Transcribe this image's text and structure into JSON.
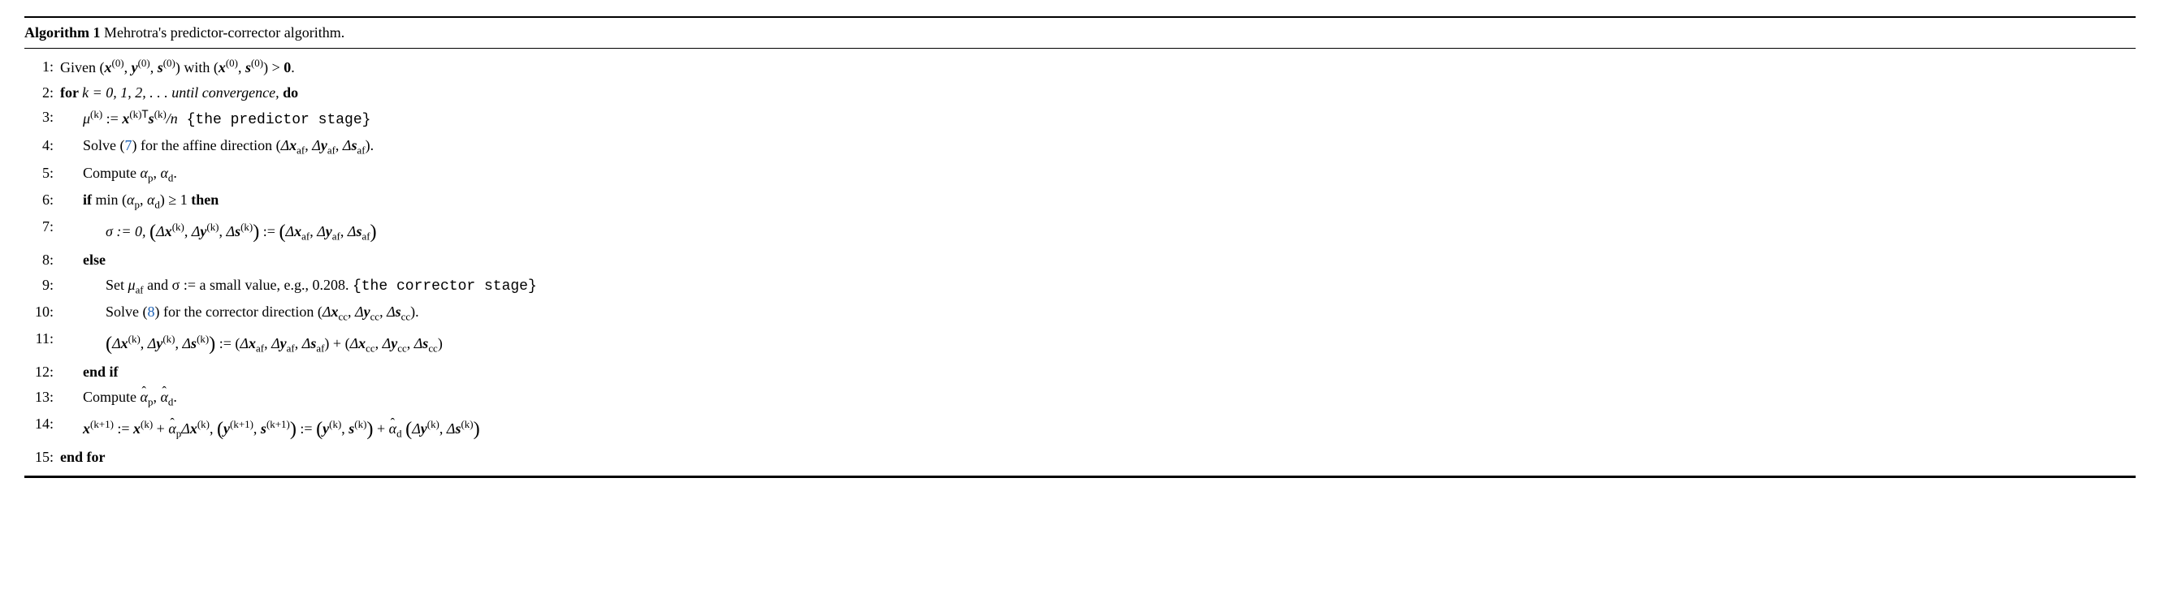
{
  "algorithm": {
    "number": "1",
    "title": "Mehrotra's predictor-corrector algorithm.",
    "label": "Algorithm",
    "ref_7": "7",
    "ref_8": "8",
    "lines": {
      "l1": {
        "no": "1:",
        "given": "Given ",
        "with": " with ",
        "gt": " > ",
        "zero": "0",
        "dot": "."
      },
      "l2": {
        "no": "2:",
        "for": "for ",
        "text": "k = 0, 1, 2, . . . until convergence,",
        "do": " do"
      },
      "l3": {
        "no": "3:",
        "mu": "μ",
        "assign": " := ",
        "div_n": "/n",
        "comment": " {the predictor stage}"
      },
      "l4": {
        "no": "4:",
        "text1": "Solve (",
        "text2": ") for the affine direction (",
        "text3": ")."
      },
      "l5": {
        "no": "5:",
        "text": "Compute ",
        "comma": ",  ",
        "dot": "."
      },
      "l6": {
        "no": "6:",
        "if": "if ",
        "min": "min",
        "lp": " (",
        "comma": ",  ",
        "rp": ") ≥ 1 ",
        "then": "then"
      },
      "l7": {
        "no": "7:",
        "sigma": "σ := 0, "
      },
      "l8": {
        "no": "8:",
        "else": "else"
      },
      "l9": {
        "no": "9:",
        "text1": "Set ",
        "muaf": "μ",
        "text2": " and σ := a small value, e.g., 0.208. ",
        "comment": "{the corrector stage}"
      },
      "l10": {
        "no": "10:",
        "text1": "Solve (",
        "text2": ") for the corrector direction (",
        "text3": ")."
      },
      "l11": {
        "no": "11:",
        "assign": " := ",
        "plus": " + "
      },
      "l12": {
        "no": "12:",
        "endif": "end if"
      },
      "l13": {
        "no": "13:",
        "text": "Compute ",
        "comma": ",  ",
        "dot": "."
      },
      "l14": {
        "no": "14:",
        "assign1": " := ",
        "plus1": " + ",
        "comma": ", ",
        "assign2": " := ",
        "plus2": " + "
      },
      "l15": {
        "no": "15:",
        "endfor": "end for"
      }
    },
    "sym": {
      "x": "x",
      "y": "y",
      "s": "s",
      "k0": "(0)",
      "k": "(k)",
      "k1": "(k+1)",
      "af": "af",
      "cc": "cc",
      "p": "p",
      "d": "d",
      "alpha": "α",
      "Delta": "Δ",
      "T": "T"
    }
  }
}
